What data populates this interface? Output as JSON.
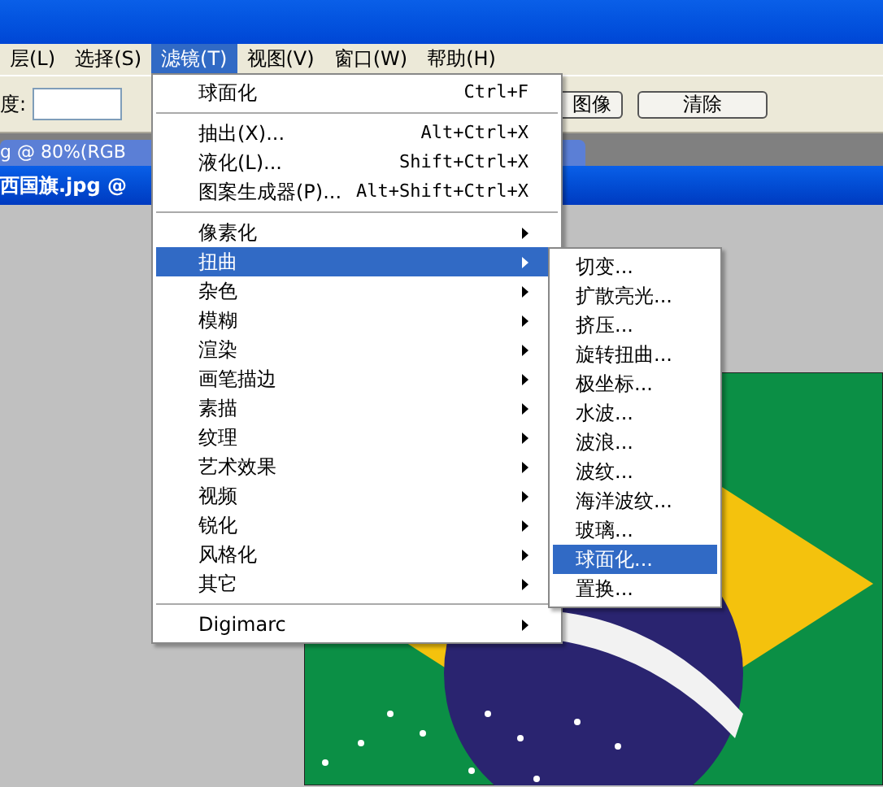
{
  "menubar": {
    "items": [
      {
        "label": "层(L)",
        "selected": false
      },
      {
        "label": "选择(S)",
        "selected": false
      },
      {
        "label": "滤镜(T)",
        "selected": true
      },
      {
        "label": "视图(V)",
        "selected": false
      },
      {
        "label": "窗口(W)",
        "selected": false
      },
      {
        "label": "帮助(H)",
        "selected": false
      }
    ]
  },
  "toolbar": {
    "field_label": "度:",
    "buttons": [
      "图像",
      "清除"
    ]
  },
  "background_tab": {
    "title": "g @ 80%(RGB"
  },
  "document": {
    "title": "西国旗.jpg @"
  },
  "filter_menu": {
    "sections": [
      [
        {
          "label": "球面化",
          "shortcut": "Ctrl+F",
          "has_submenu": false,
          "selected": false
        }
      ],
      [
        {
          "label": "抽出(X)...",
          "shortcut": "Alt+Ctrl+X",
          "has_submenu": false,
          "selected": false
        },
        {
          "label": "液化(L)...",
          "shortcut": "Shift+Ctrl+X",
          "has_submenu": false,
          "selected": false
        },
        {
          "label": "图案生成器(P)...",
          "shortcut": "Alt+Shift+Ctrl+X",
          "has_submenu": false,
          "selected": false
        }
      ],
      [
        {
          "label": "像素化",
          "has_submenu": true,
          "selected": false
        },
        {
          "label": "扭曲",
          "has_submenu": true,
          "selected": true
        },
        {
          "label": "杂色",
          "has_submenu": true,
          "selected": false
        },
        {
          "label": "模糊",
          "has_submenu": true,
          "selected": false
        },
        {
          "label": "渲染",
          "has_submenu": true,
          "selected": false
        },
        {
          "label": "画笔描边",
          "has_submenu": true,
          "selected": false
        },
        {
          "label": "素描",
          "has_submenu": true,
          "selected": false
        },
        {
          "label": "纹理",
          "has_submenu": true,
          "selected": false
        },
        {
          "label": "艺术效果",
          "has_submenu": true,
          "selected": false
        },
        {
          "label": "视频",
          "has_submenu": true,
          "selected": false
        },
        {
          "label": "锐化",
          "has_submenu": true,
          "selected": false
        },
        {
          "label": "风格化",
          "has_submenu": true,
          "selected": false
        },
        {
          "label": "其它",
          "has_submenu": true,
          "selected": false
        }
      ],
      [
        {
          "label": "Digimarc",
          "has_submenu": true,
          "selected": false
        }
      ]
    ]
  },
  "distort_submenu": {
    "items": [
      {
        "label": "切变...",
        "selected": false
      },
      {
        "label": "扩散亮光...",
        "selected": false
      },
      {
        "label": "挤压...",
        "selected": false
      },
      {
        "label": "旋转扭曲...",
        "selected": false
      },
      {
        "label": "极坐标...",
        "selected": false
      },
      {
        "label": "水波...",
        "selected": false
      },
      {
        "label": "波浪...",
        "selected": false
      },
      {
        "label": "波纹...",
        "selected": false
      },
      {
        "label": "海洋波纹...",
        "selected": false
      },
      {
        "label": "玻璃...",
        "selected": false
      },
      {
        "label": "球面化...",
        "selected": true
      },
      {
        "label": "置换...",
        "selected": false
      }
    ]
  }
}
